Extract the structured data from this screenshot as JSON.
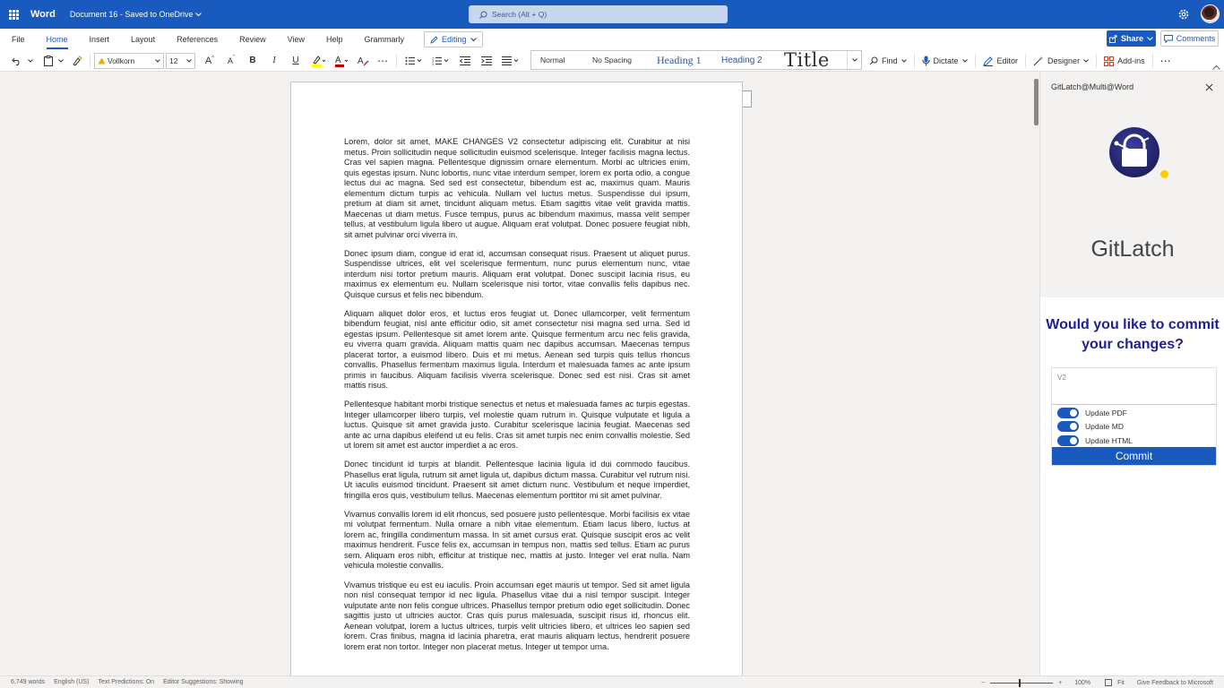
{
  "titlebar": {
    "app_name": "Word",
    "doc_name": "Document 16 - Saved to OneDrive",
    "search_placeholder": "Search (Alt + Q)"
  },
  "tabs": [
    "File",
    "Home",
    "Insert",
    "Layout",
    "References",
    "Review",
    "View",
    "Help",
    "Grammarly"
  ],
  "active_tab": "Home",
  "editing_mode": "Editing",
  "share_label": "Share",
  "comments_label": "Comments",
  "toolbar": {
    "font_name": "Vollkorn",
    "font_size": "12",
    "bold": "B",
    "italic": "I",
    "underline": "U",
    "styles": [
      "Normal",
      "No Spacing",
      "Heading 1",
      "Heading 2",
      "Title"
    ],
    "find": "Find",
    "dictate": "Dictate",
    "editor": "Editor",
    "designer": "Designer",
    "addins": "Add-ins"
  },
  "document": {
    "paragraphs": [
      "Lorem, dolor sit amet, MAKE CHANGES V2 consectetur adipiscing elit. Curabitur at nisi metus. Proin sollicitudin neque sollicitudin euismod scelerisque. Integer facilisis magna lectus. Cras vel sapien magna. Pellentesque dignissim ornare elementum. Morbi ac ultricies enim, quis egestas ipsum. Nunc lobortis, nunc vitae interdum semper, lorem ex porta odio, a congue lectus dui ac magna. Sed sed est consectetur, bibendum est ac, maximus quam. Mauris elementum dictum turpis ac vehicula. Nullam vel luctus metus. Suspendisse dui ipsum, pretium at diam sit amet, tincidunt aliquam metus. Etiam sagittis vitae velit gravida mattis. Maecenas ut diam metus. Fusce tempus, purus ac bibendum maximus, massa velit semper tellus, at vestibulum ligula libero ut augue. Aliquam erat volutpat. Donec posuere feugiat nibh, sit amet pulvinar orci viverra in.",
      "Donec ipsum diam, congue id erat id, accumsan consequat risus. Praesent ut aliquet purus. Suspendisse ultrices, elit vel scelerisque fermentum, nunc purus elementum nunc, vitae interdum nisi tortor pretium mauris. Aliquam erat volutpat. Donec suscipit lacinia risus, eu maximus ex elementum eu. Nullam scelerisque nisi tortor, vitae convallis felis dapibus nec. Quisque cursus et felis nec bibendum.",
      "Aliquam aliquet dolor eros, et luctus eros feugiat ut. Donec ullamcorper, velit fermentum bibendum feugiat, nisl ante efficitur odio, sit amet consectetur nisi magna sed urna. Sed id egestas ipsum. Pellentesque sit amet lorem ante. Quisque fermentum arcu nec felis gravida, eu viverra quam gravida. Aliquam mattis quam nec dapibus accumsan. Maecenas tempus placerat tortor, a euismod libero. Duis et mi metus. Aenean sed turpis quis tellus rhoncus convallis. Phasellus fermentum maximus ligula. Interdum et malesuada fames ac ante ipsum primis in faucibus. Aliquam facilisis viverra scelerisque. Donec sed est nisi. Cras sit amet mattis risus.",
      "Pellentesque habitant morbi tristique senectus et netus et malesuada fames ac turpis egestas. Integer ullamcorper libero turpis, vel molestie quam rutrum in. Quisque vulputate et ligula a luctus. Quisque sit amet gravida justo. Curabitur scelerisque lacinia feugiat. Maecenas sed ante ac urna dapibus eleifend ut eu felis. Cras sit amet turpis nec enim convallis molestie. Sed ut lorem sit amet est auctor imperdiet a ac eros.",
      "Donec tincidunt id turpis at blandit. Pellentesque lacinia ligula id dui commodo faucibus. Phasellus erat ligula, rutrum sit amet ligula ut, dapibus dictum massa. Curabitur vel rutrum nisi. Ut iaculis euismod tincidunt. Praesent sit amet dictum nunc. Vestibulum et neque imperdiet, fringilla eros quis, vestibulum tellus. Maecenas elementum porttitor mi sit amet pulvinar.",
      "Vivamus convallis lorem id elit rhoncus, sed posuere justo pellentesque. Morbi facilisis ex vitae mi volutpat fermentum. Nulla ornare a nibh vitae elementum. Etiam lacus libero, luctus at lorem ac, fringilla condimentum massa. In sit amet cursus erat. Quisque suscipit eros ac velit maximus hendrerit. Fusce felis ex, accumsan in tempus non, mattis sed tellus. Etiam ac purus sem. Aliquam eros nibh, efficitur at tristique nec, mattis at justo. Integer vel erat nulla. Nam vehicula molestie convallis.",
      "Vivamus tristique eu est eu iaculis. Proin accumsan eget mauris ut tempor. Sed sit amet ligula non nisl consequat tempor id nec ligula. Phasellus vitae dui a nisl tempor suscipit. Integer vulputate ante non felis congue ultrices. Phasellus tempor pretium odio eget sollicitudin. Donec sagittis justo ut ultricies auctor. Cras quis purus malesuada, suscipit risus id, rhoncus elit. Aenean volutpat, lorem a luctus ultrices, turpis velit ultricies libero, et ultrices leo sapien sed lorem. Cras finibus, magna id lacinia pharetra, erat mauris aliquam lectus, hendrerit posuere lorem erat non tortor. Integer non placerat metus. Integer ut tempor urna."
    ]
  },
  "panel": {
    "header": "GitLatch@Multi@Word",
    "brand": "GitLatch",
    "question": "Would you like to commit your changes?",
    "commit_message": "V2",
    "toggles": [
      "Update PDF",
      "Update MD",
      "Update HTML"
    ],
    "commit_label": "Commit"
  },
  "statusbar": {
    "word_count": "6,749 words",
    "language": "English (US)",
    "text_predictions": "Text Predictions: On",
    "editor_suggestions": "Editor Suggestions: Showing",
    "zoom": "100%",
    "fit": "Fit",
    "feedback": "Give Feedback to Microsoft"
  },
  "colors": {
    "accent": "#185abd",
    "question": "#1f1f8f",
    "logo_dot": "#ffcc00"
  }
}
